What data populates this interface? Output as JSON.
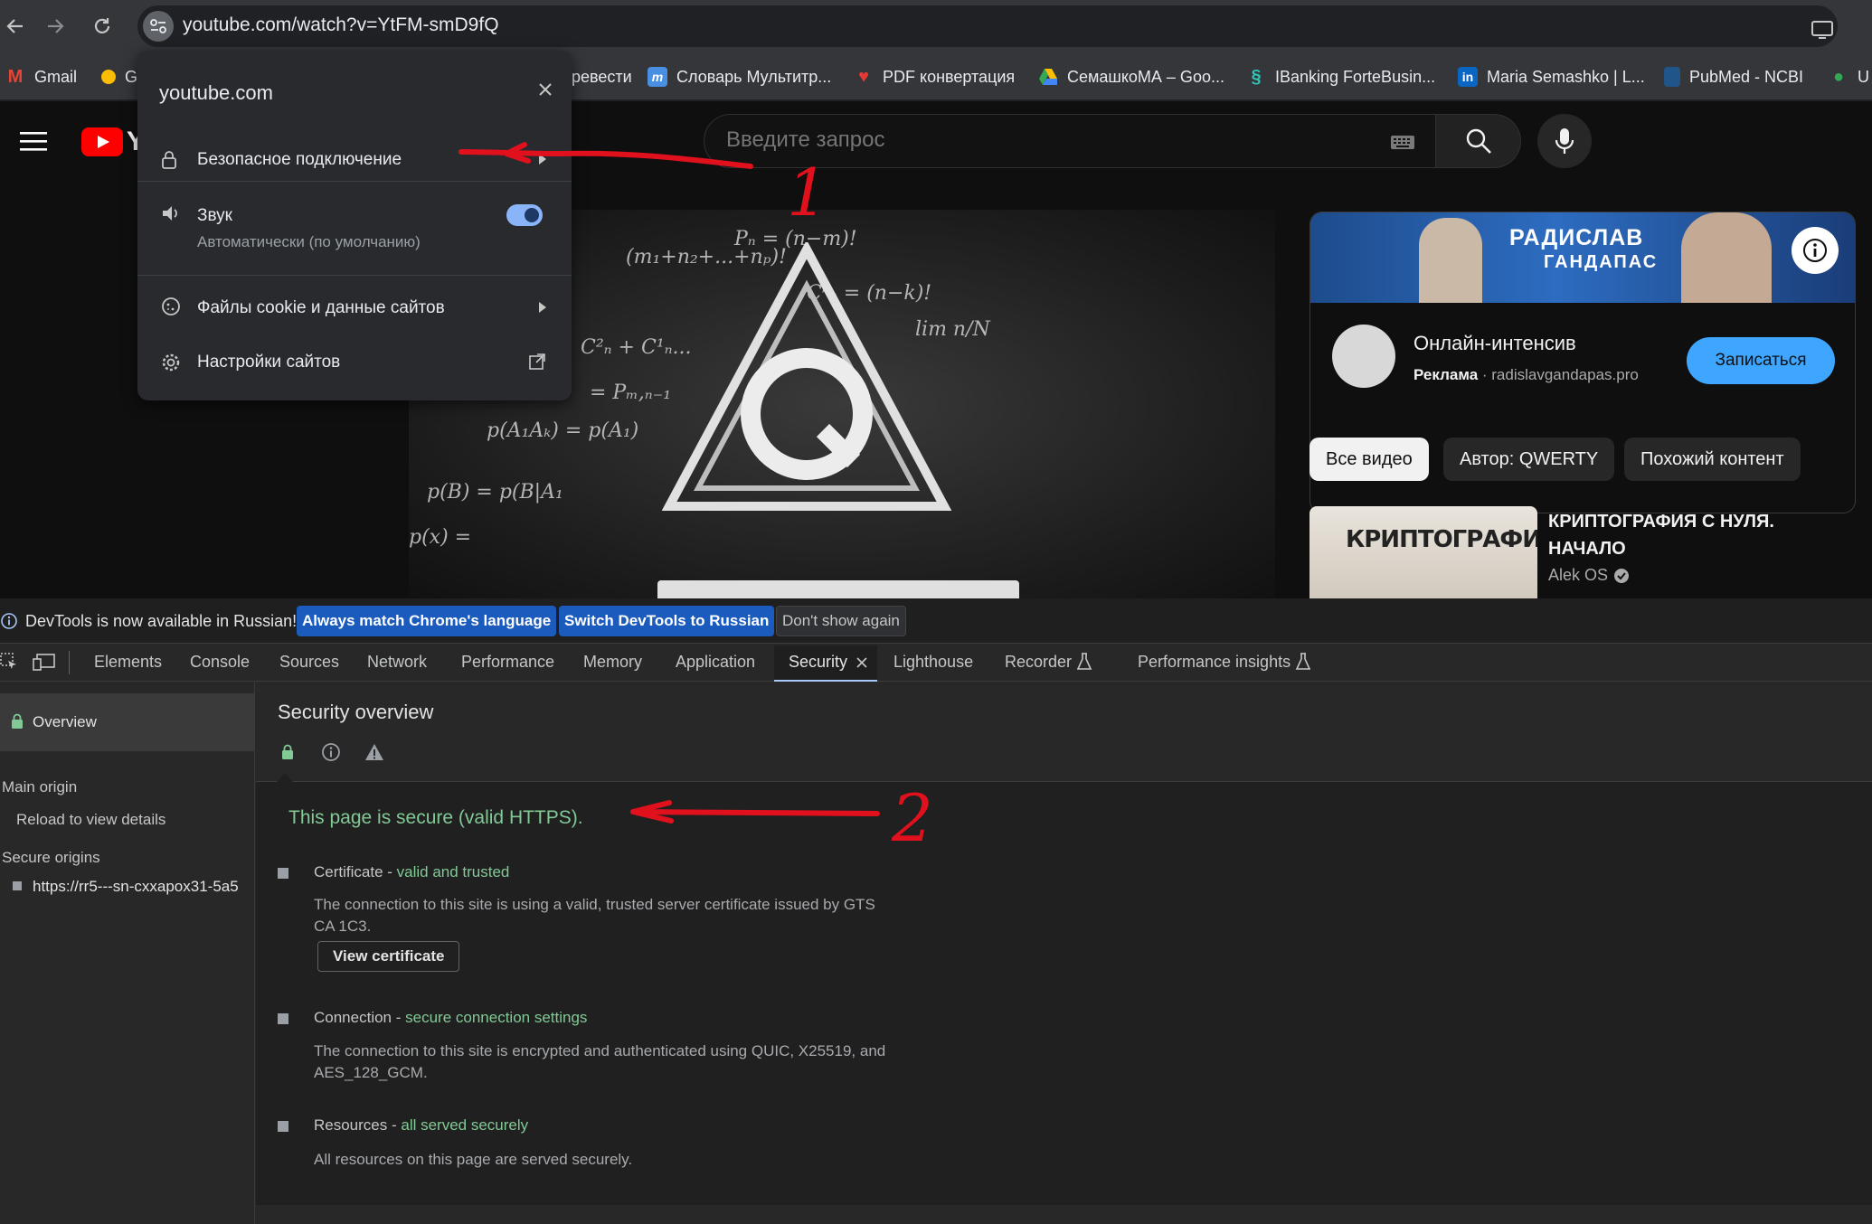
{
  "browser": {
    "url": "youtube.com/watch?v=YtFM-smD9fQ",
    "bookmarks": [
      {
        "label": "Gmail",
        "icon": "gmail-icon",
        "color": "#ea4335"
      },
      {
        "label": "G",
        "icon": "bulb-icon",
        "color": "#fbbc04"
      },
      {
        "label": "ревести",
        "icon": "",
        "color": ""
      },
      {
        "label": "Словарь Мультитр...",
        "icon": "multitran-icon",
        "color": "#4a90e2"
      },
      {
        "label": "PDF конвертация",
        "icon": "pdf-heart-icon",
        "color": "#e53935"
      },
      {
        "label": "СемашкоМА – Goo...",
        "icon": "google-drive-icon",
        "color": "#34a853"
      },
      {
        "label": "IBanking ForteBusin...",
        "icon": "forte-icon",
        "color": "#2ec4b6"
      },
      {
        "label": "Maria Semashko | L...",
        "icon": "linkedin-icon",
        "color": "#0a66c2"
      },
      {
        "label": "PubMed - NCBI",
        "icon": "pubmed-icon",
        "color": "#20558a"
      },
      {
        "label": "U",
        "icon": "person-icon",
        "color": "#34a853"
      }
    ]
  },
  "popup": {
    "domain": "youtube.com",
    "secure_connection": "Безопасное подключение",
    "sound_label": "Звук",
    "sound_sub": "Автоматически (по умолчанию)",
    "sound_enabled": true,
    "cookies": "Файлы cookie и данные сайтов",
    "site_settings": "Настройки сайтов"
  },
  "youtube": {
    "logo_text": "YT",
    "search_placeholder": "Введите запрос",
    "chalk_formulas": [
      "(m₁+n₂+...+nₚ)!",
      "C²ₙ + C¹ₙ... ",
      "= Pₘ,ₙ₋₁",
      "p(A₁Aₖ) = p(A₁)",
      "p(B) = p(B|A₁",
      "p(x) =",
      "lim n/N",
      "Cᵏₙ = (n−k)!",
      "Pₙ = (n−m)!"
    ],
    "ad": {
      "banner_title": "РАДИСЛАВ",
      "banner_sub": "ГАНДАПАС",
      "title": "Онлайн-интенсив",
      "sponsored": "Реклама",
      "domain": "radislavgandapas.pro",
      "cta": "Записаться"
    },
    "chips": [
      "Все видео",
      "Автор: QWERTY",
      "Похожий контент"
    ],
    "recommendation": {
      "thumb_text": "КРИПТОГРАФИЯ",
      "title": "КРИПТОГРАФИЯ С НУЛЯ. НАЧАЛО",
      "channel": "Alek OS"
    }
  },
  "devtools": {
    "infobar": {
      "message": "DevTools is now available in Russian!",
      "btn_match": "Always match Chrome's language",
      "btn_switch": "Switch DevTools to Russian",
      "btn_dismiss": "Don't show again"
    },
    "tabs": [
      "Elements",
      "Console",
      "Sources",
      "Network",
      "Performance",
      "Memory",
      "Application",
      "Security",
      "Lighthouse",
      "Recorder",
      "Performance insights"
    ],
    "active_tab": "Security",
    "sidebar": {
      "overview": "Overview",
      "main_origin": "Main origin",
      "reload": "Reload to view details",
      "secure_origins": "Secure origins",
      "origin_url": "https://rr5---sn-cxxapox31-5a5"
    },
    "title": "Security overview",
    "summary": "This page is secure (valid HTTPS).",
    "certificate": {
      "head": "Certificate - ",
      "status": "valid and trusted",
      "desc": "The connection to this site is using a valid, trusted server certificate issued by GTS CA 1C3.",
      "button": "View certificate"
    },
    "connection": {
      "head": "Connection - ",
      "status": "secure connection settings",
      "desc": "The connection to this site is encrypted and authenticated using QUIC, X25519, and AES_128_GCM."
    },
    "resources": {
      "head": "Resources - ",
      "status": "all served securely",
      "desc": "All resources on this page are served securely."
    }
  },
  "annotations": {
    "label_1": "1",
    "label_2": "2",
    "color": "#e0101c"
  },
  "colors": {
    "secure_green": "#81c995",
    "accent_blue": "#8ab4f8",
    "yt_red": "#ff0000",
    "cta_blue": "#3ea6ff"
  }
}
